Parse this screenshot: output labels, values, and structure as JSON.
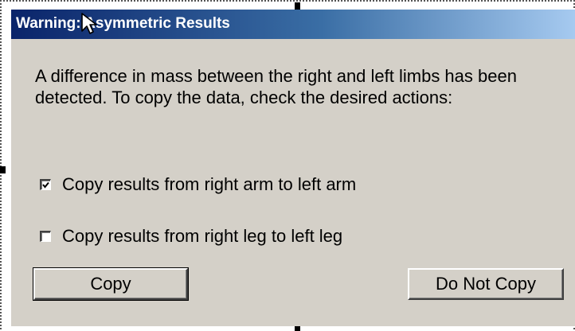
{
  "dialog": {
    "title": "Warning: Asymmetric Results",
    "message": "A difference in mass between the right and left limbs has been detected.  To copy the data, check the desired actions:",
    "options": [
      {
        "label": "Copy results from right arm to left arm",
        "checked": true
      },
      {
        "label": "Copy results from right leg to left leg",
        "checked": false
      }
    ],
    "buttons": {
      "copy": "Copy",
      "do_not_copy": "Do Not Copy"
    }
  },
  "colors": {
    "dialog_face": "#d4d0c8",
    "title_gradient_start": "#0a246a",
    "title_gradient_end": "#a6caf0",
    "title_text": "#ffffff"
  },
  "icons": {
    "cursor": "arrow-cursor-icon",
    "checkmark": "checkmark-icon"
  }
}
